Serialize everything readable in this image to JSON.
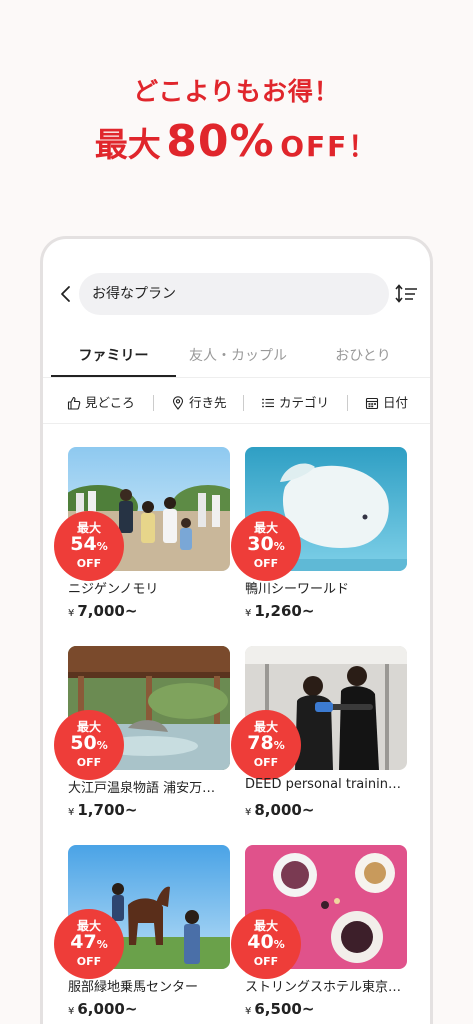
{
  "promo": {
    "subtitle": "どこよりもお得！",
    "main_prefix": "最大",
    "main_number": "80%",
    "main_suffix": "OFF！"
  },
  "search": {
    "value": "お得なプラン"
  },
  "tabs": [
    {
      "label": "ファミリー",
      "active": true
    },
    {
      "label": "友人・カップル",
      "active": false
    },
    {
      "label": "おひとり",
      "active": false
    }
  ],
  "filters": [
    {
      "label": "見どころ",
      "icon": "thumbs-up-icon"
    },
    {
      "label": "行き先",
      "icon": "location-pin-icon"
    },
    {
      "label": "カテゴリ",
      "icon": "list-icon"
    },
    {
      "label": "日付",
      "icon": "calendar-icon"
    }
  ],
  "badge_labels": {
    "top": "最大",
    "bottom": "OFF",
    "unit": "%"
  },
  "cards": [
    {
      "title": "ニジゲンノモリ",
      "discount": "54",
      "currency": "¥",
      "price": "7,000~"
    },
    {
      "title": "鴨川シーワールド",
      "discount": "30",
      "currency": "¥",
      "price": "1,260~"
    },
    {
      "title": "大江戸温泉物語 浦安万…",
      "discount": "50",
      "currency": "¥",
      "price": "1,700~"
    },
    {
      "title": "DEED personal trainin…",
      "discount": "78",
      "currency": "¥",
      "price": "8,000~"
    },
    {
      "title": "服部緑地乗馬センター",
      "discount": "47",
      "currency": "¥",
      "price": "6,000~"
    },
    {
      "title": "ストリングスホテル東京…",
      "discount": "40",
      "currency": "¥",
      "price": "6,500~"
    }
  ],
  "colors": {
    "accent": "#e0262c",
    "badge": "#ee3d39"
  }
}
